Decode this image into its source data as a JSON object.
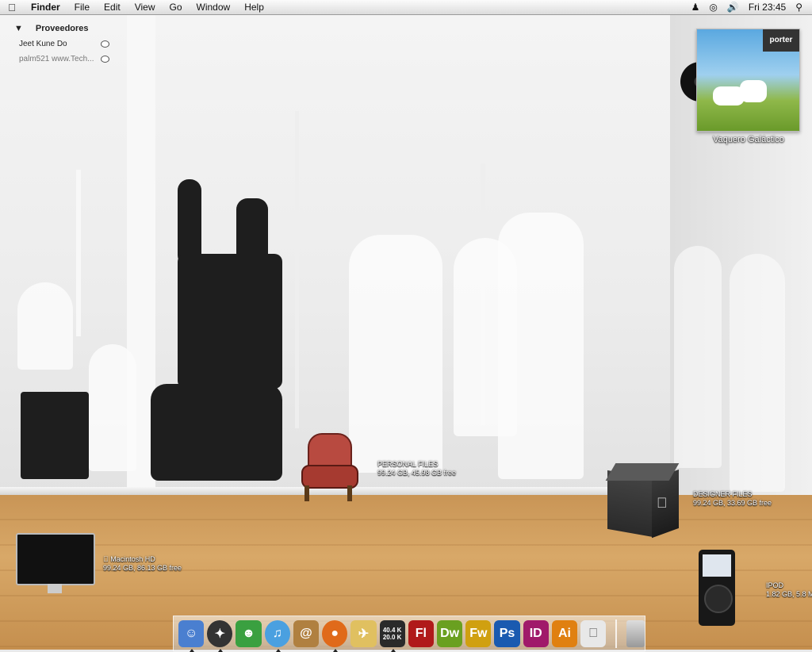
{
  "menubar": {
    "apple": "",
    "app_name": "Finder",
    "menus": [
      "File",
      "Edit",
      "View",
      "Go",
      "Window",
      "Help"
    ],
    "clock": "Fri 23:45",
    "icons": [
      "user-icon",
      "airport-icon",
      "volume-icon",
      "spotlight-icon"
    ]
  },
  "providers": {
    "title": "Proveedores",
    "items": [
      {
        "label": "Jeet Kune Do"
      },
      {
        "label": "palm521 www.Tech..."
      }
    ]
  },
  "album": {
    "band": "porter",
    "title": "Vaquero Galáctico"
  },
  "desktop": {
    "personal": {
      "name": "PERSONAL FILES",
      "info": "99.24 GB, 45.98 GB free"
    },
    "designer": {
      "name": "DESIGNER FILES",
      "info": "99.24 GB, 33.69 GB free"
    },
    "mac_hd": {
      "name": "Macintosh HD",
      "info": "99.24 GB, 86.13 GB free"
    },
    "ipod": {
      "name": "IPOD",
      "info": "1.82 GB, 5.8 M"
    }
  },
  "dock": {
    "items": [
      {
        "name": "finder",
        "label": "",
        "color": "#4a7fd0"
      },
      {
        "name": "safari-dashboard",
        "label": "",
        "color": "#333333"
      },
      {
        "name": "adium",
        "label": "",
        "color": "#3aa040"
      },
      {
        "name": "itunes",
        "label": "",
        "color": "#4aa0e0"
      },
      {
        "name": "address-book",
        "label": "@",
        "color": "#b08040"
      },
      {
        "name": "firefox",
        "label": "",
        "color": "#e06a1a"
      },
      {
        "name": "transmit",
        "label": "",
        "color": "#e0c060"
      },
      {
        "name": "network-monitor",
        "label": "",
        "color": "#2a2a2a"
      },
      {
        "name": "flash",
        "label": "Fl",
        "color": "#b01a1a"
      },
      {
        "name": "dreamweaver",
        "label": "Dw",
        "color": "#6aa020"
      },
      {
        "name": "fireworks",
        "label": "Fw",
        "color": "#d0a010"
      },
      {
        "name": "photoshop",
        "label": "Ps",
        "color": "#1a5ab0"
      },
      {
        "name": "indesign",
        "label": "ID",
        "color": "#a01a6a"
      },
      {
        "name": "illustrator",
        "label": "Ai",
        "color": "#e08010"
      },
      {
        "name": "system-prefs",
        "label": "",
        "color": "#c0c0c0"
      }
    ],
    "net_up": "40.4 K",
    "net_down": "20.0 K"
  }
}
